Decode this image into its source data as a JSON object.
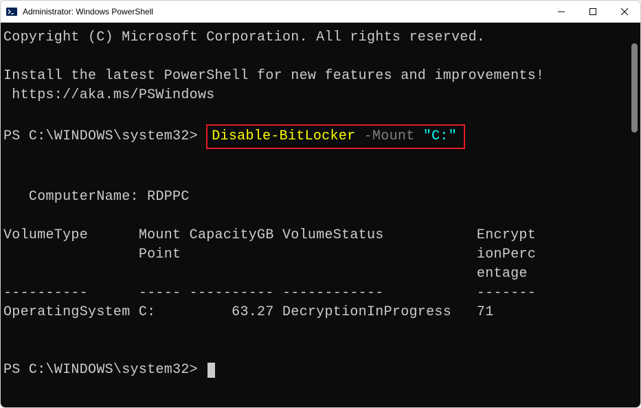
{
  "window": {
    "title": "Administrator: Windows PowerShell"
  },
  "terminal": {
    "copyright": "Copyright (C) Microsoft Corporation. All rights reserved.",
    "install_msg": "Install the latest PowerShell for new features and improvements!",
    "install_url": " https://aka.ms/PSWindows",
    "prompt1": "PS C:\\WINDOWS\\system32> ",
    "command": {
      "cmdlet": "Disable-BitLocker",
      "param": " -Mount ",
      "value": "\"C:\""
    },
    "computer_label": "   ComputerName: ",
    "computer_name": "RDPPC",
    "headers": "VolumeType      Mount CapacityGB VolumeStatus           Encrypt\n                Point                                   ionPerc\n                                                        entage",
    "divider": "----------      ----- ---------- ------------           -------",
    "row": "OperatingSystem C:         63.27 DecryptionInProgress   71",
    "prompt2": "PS C:\\WINDOWS\\system32> "
  }
}
